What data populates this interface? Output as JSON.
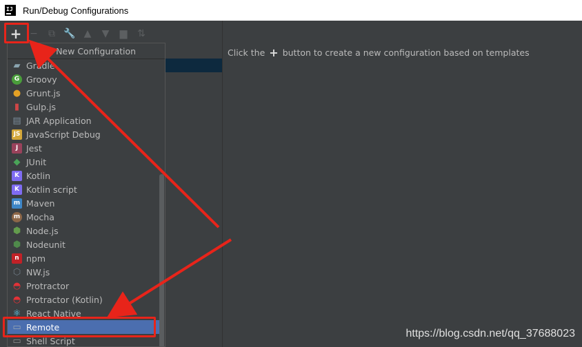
{
  "window": {
    "title": "Run/Debug Configurations",
    "logo_text": "IJ"
  },
  "toolbar": {
    "buttons": [
      {
        "icon": "plus-icon",
        "glyph": "+"
      },
      {
        "icon": "minus-icon",
        "glyph": "−"
      },
      {
        "icon": "copy-icon",
        "glyph": "⧉"
      },
      {
        "icon": "wrench-icon",
        "glyph": "🔧"
      },
      {
        "icon": "arrow-up-icon",
        "glyph": "▲"
      },
      {
        "icon": "arrow-down-icon",
        "glyph": "▼"
      },
      {
        "icon": "folder-icon",
        "glyph": "▆"
      },
      {
        "icon": "sort-icon",
        "glyph": "⇅"
      }
    ]
  },
  "hint": {
    "before": "Click the",
    "plus": "+",
    "after": "button to create a new configuration based on templates"
  },
  "popup": {
    "header": "Add New Configuration",
    "items": [
      {
        "label": "Gradle",
        "icon": "gradle-icon",
        "color": "#8aa4b0",
        "glyph": "▰"
      },
      {
        "label": "Groovy",
        "icon": "groovy-icon",
        "color": "#4a9e3b",
        "glyph": "G"
      },
      {
        "label": "Grunt.js",
        "icon": "grunt-icon",
        "color": "#e4a125",
        "glyph": "●"
      },
      {
        "label": "Gulp.js",
        "icon": "gulp-icon",
        "color": "#cf4647",
        "glyph": "▮"
      },
      {
        "label": "JAR Application",
        "icon": "jar-icon",
        "color": "#7b8b9a",
        "glyph": "▤"
      },
      {
        "label": "JavaScript Debug",
        "icon": "js-debug-icon",
        "color": "#d4a73a",
        "glyph": "JS"
      },
      {
        "label": "Jest",
        "icon": "jest-icon",
        "color": "#99425b",
        "glyph": "J"
      },
      {
        "label": "JUnit",
        "icon": "junit-icon",
        "color": "#4aa458",
        "glyph": "◆"
      },
      {
        "label": "Kotlin",
        "icon": "kotlin-icon",
        "color": "#7f6cf2",
        "glyph": "K"
      },
      {
        "label": "Kotlin script",
        "icon": "kotlin-script-icon",
        "color": "#7f6cf2",
        "glyph": "K"
      },
      {
        "label": "Maven",
        "icon": "maven-icon",
        "color": "#3e86c6",
        "glyph": "m"
      },
      {
        "label": "Mocha",
        "icon": "mocha-icon",
        "color": "#8d6748",
        "glyph": "m"
      },
      {
        "label": "Node.js",
        "icon": "nodejs-icon",
        "color": "#639c4d",
        "glyph": "⬢"
      },
      {
        "label": "Nodeunit",
        "icon": "nodeunit-icon",
        "color": "#4f8a4b",
        "glyph": "⬢"
      },
      {
        "label": "npm",
        "icon": "npm-icon",
        "color": "#c12127",
        "glyph": "n"
      },
      {
        "label": "NW.js",
        "icon": "nwjs-icon",
        "color": "#6f7a85",
        "glyph": "⬡"
      },
      {
        "label": "Protractor",
        "icon": "protractor-icon",
        "color": "#e23237",
        "glyph": "◓"
      },
      {
        "label": "Protractor (Kotlin)",
        "icon": "protractor-kotlin-icon",
        "color": "#e23237",
        "glyph": "◓"
      },
      {
        "label": "React Native",
        "icon": "react-native-icon",
        "color": "#61dafb",
        "glyph": "⚛"
      },
      {
        "label": "Remote",
        "icon": "remote-icon",
        "color": "#9aa7b3",
        "glyph": "▭",
        "selected": true
      },
      {
        "label": "Shell Script",
        "icon": "shell-script-icon",
        "color": "#8c8c8c",
        "glyph": "▭"
      }
    ]
  },
  "watermark": "https://blog.csdn.net/qq_37688023",
  "colors": {
    "annotation": "#e8241a",
    "selection": "#4b6eaf",
    "background": "#3c3f41"
  }
}
